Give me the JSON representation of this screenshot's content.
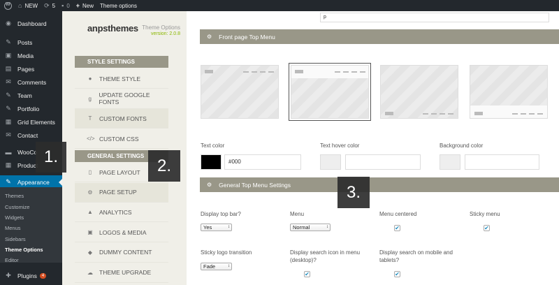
{
  "admin_bar": {
    "site_name": "NEW",
    "updates_count": "5",
    "comments_count": "0",
    "new_label": "New",
    "theme_options_label": "Theme options"
  },
  "sidebar": {
    "items": [
      {
        "label": "Dashboard",
        "icon": "dashboard-icon",
        "glyph": "◉"
      },
      {
        "label": "Posts",
        "icon": "pin-icon",
        "glyph": "✎"
      },
      {
        "label": "Media",
        "icon": "media-icon",
        "glyph": "▣"
      },
      {
        "label": "Pages",
        "icon": "pages-icon",
        "glyph": "▤"
      },
      {
        "label": "Comments",
        "icon": "comments-icon",
        "glyph": "✉"
      },
      {
        "label": "Team",
        "icon": "pin-icon",
        "glyph": "✎"
      },
      {
        "label": "Portfolio",
        "icon": "pin-icon",
        "glyph": "✎"
      },
      {
        "label": "Grid Elements",
        "icon": "grid-icon",
        "glyph": "▦"
      },
      {
        "label": "Contact",
        "icon": "mail-icon",
        "glyph": "✉"
      },
      {
        "label": "WooCo",
        "icon": "woocommerce-icon",
        "glyph": "▬"
      },
      {
        "label": "Product",
        "icon": "products-icon",
        "glyph": "▦"
      },
      {
        "label": "Appearance",
        "icon": "brush-icon",
        "glyph": "✎"
      }
    ],
    "submenu": [
      "Themes",
      "Customize",
      "Widgets",
      "Menus",
      "Sidebars",
      "Theme Options",
      "Editor"
    ],
    "plugins_label": "Plugins",
    "plugins_badge": "4"
  },
  "tags": {
    "one": "1.",
    "two": "2.",
    "three": "3."
  },
  "options_sidebar": {
    "brand": "anpsthemes",
    "subtitle": "Theme Options",
    "version": "version: 2.0.8",
    "style_header": "STYLE SETTINGS",
    "style_items": [
      {
        "label": "THEME STYLE",
        "icon": "drop-icon",
        "glyph": "●"
      },
      {
        "label": "UPDATE GOOGLE FONTS",
        "icon": "google-icon",
        "glyph": "g"
      },
      {
        "label": "CUSTOM FONTS",
        "icon": "font-icon",
        "glyph": "T"
      },
      {
        "label": "CUSTOM CSS",
        "icon": "code-icon",
        "glyph": "</>"
      }
    ],
    "general_header": "GENERAL SETTINGS",
    "general_items": [
      {
        "label": "PAGE LAYOUT",
        "icon": "layout-icon",
        "glyph": "▯"
      },
      {
        "label": "PAGE SETUP",
        "icon": "gear-icon",
        "glyph": "⚙"
      },
      {
        "label": "ANALYTICS",
        "icon": "chart-icon",
        "glyph": "▲"
      },
      {
        "label": "LOGOS & MEDIA",
        "icon": "image-icon",
        "glyph": "▣"
      },
      {
        "label": "DUMMY CONTENT",
        "icon": "dropbox-icon",
        "glyph": "◆"
      },
      {
        "label": "THEME UPGRADE",
        "icon": "cloud-icon",
        "glyph": "☁"
      }
    ]
  },
  "main": {
    "top_input_value": "p",
    "front_page_bar": "Front page Top Menu",
    "text_color_label": "Text color",
    "text_color_value": "#000",
    "text_color_hex": "#000000",
    "text_hover_label": "Text hover color",
    "background_color_label": "Background color",
    "general_bar": "General Top Menu Settings",
    "display_top_bar_label": "Display top bar?",
    "display_top_bar_value": "Yes",
    "menu_label": "Menu",
    "menu_value": "Normal",
    "menu_centered_label": "Menu centered",
    "sticky_menu_label": "Sticky menu",
    "sticky_logo_label": "Sticky logo transition",
    "sticky_logo_value": "Fade",
    "search_icon_label_1": "Display search icon in menu",
    "search_icon_label_2": "(desktop)?",
    "search_mobile_label_1": "Display search on mobile and",
    "search_mobile_label_2": "tablets?",
    "check_glyph": "✔"
  }
}
